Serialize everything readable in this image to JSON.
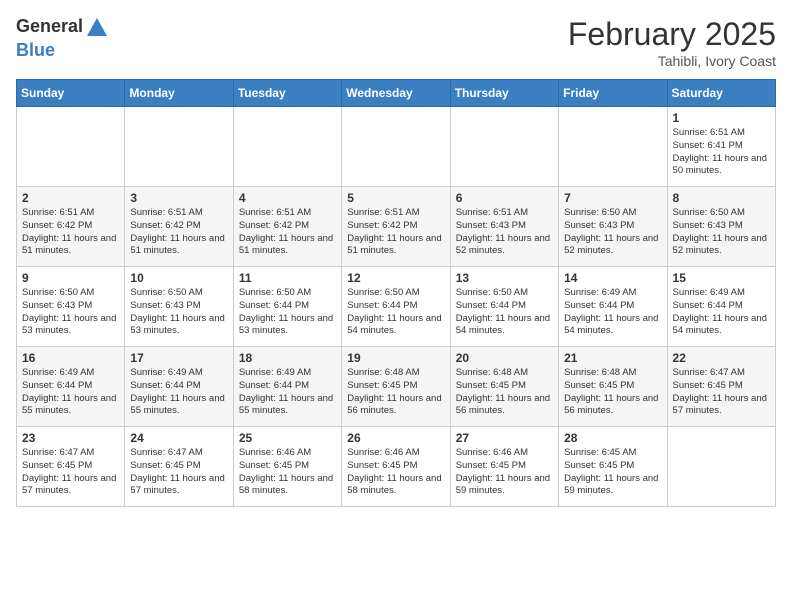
{
  "header": {
    "logo_general": "General",
    "logo_blue": "Blue",
    "month_title": "February 2025",
    "subtitle": "Tahibli, Ivory Coast"
  },
  "days_of_week": [
    "Sunday",
    "Monday",
    "Tuesday",
    "Wednesday",
    "Thursday",
    "Friday",
    "Saturday"
  ],
  "weeks": [
    [
      {
        "day": "",
        "sunrise": "",
        "sunset": "",
        "daylight": ""
      },
      {
        "day": "",
        "sunrise": "",
        "sunset": "",
        "daylight": ""
      },
      {
        "day": "",
        "sunrise": "",
        "sunset": "",
        "daylight": ""
      },
      {
        "day": "",
        "sunrise": "",
        "sunset": "",
        "daylight": ""
      },
      {
        "day": "",
        "sunrise": "",
        "sunset": "",
        "daylight": ""
      },
      {
        "day": "",
        "sunrise": "",
        "sunset": "",
        "daylight": ""
      },
      {
        "day": "1",
        "sunrise": "Sunrise: 6:51 AM",
        "sunset": "Sunset: 6:41 PM",
        "daylight": "Daylight: 11 hours and 50 minutes."
      }
    ],
    [
      {
        "day": "2",
        "sunrise": "Sunrise: 6:51 AM",
        "sunset": "Sunset: 6:42 PM",
        "daylight": "Daylight: 11 hours and 51 minutes."
      },
      {
        "day": "3",
        "sunrise": "Sunrise: 6:51 AM",
        "sunset": "Sunset: 6:42 PM",
        "daylight": "Daylight: 11 hours and 51 minutes."
      },
      {
        "day": "4",
        "sunrise": "Sunrise: 6:51 AM",
        "sunset": "Sunset: 6:42 PM",
        "daylight": "Daylight: 11 hours and 51 minutes."
      },
      {
        "day": "5",
        "sunrise": "Sunrise: 6:51 AM",
        "sunset": "Sunset: 6:42 PM",
        "daylight": "Daylight: 11 hours and 51 minutes."
      },
      {
        "day": "6",
        "sunrise": "Sunrise: 6:51 AM",
        "sunset": "Sunset: 6:43 PM",
        "daylight": "Daylight: 11 hours and 52 minutes."
      },
      {
        "day": "7",
        "sunrise": "Sunrise: 6:50 AM",
        "sunset": "Sunset: 6:43 PM",
        "daylight": "Daylight: 11 hours and 52 minutes."
      },
      {
        "day": "8",
        "sunrise": "Sunrise: 6:50 AM",
        "sunset": "Sunset: 6:43 PM",
        "daylight": "Daylight: 11 hours and 52 minutes."
      }
    ],
    [
      {
        "day": "9",
        "sunrise": "Sunrise: 6:50 AM",
        "sunset": "Sunset: 6:43 PM",
        "daylight": "Daylight: 11 hours and 53 minutes."
      },
      {
        "day": "10",
        "sunrise": "Sunrise: 6:50 AM",
        "sunset": "Sunset: 6:43 PM",
        "daylight": "Daylight: 11 hours and 53 minutes."
      },
      {
        "day": "11",
        "sunrise": "Sunrise: 6:50 AM",
        "sunset": "Sunset: 6:44 PM",
        "daylight": "Daylight: 11 hours and 53 minutes."
      },
      {
        "day": "12",
        "sunrise": "Sunrise: 6:50 AM",
        "sunset": "Sunset: 6:44 PM",
        "daylight": "Daylight: 11 hours and 54 minutes."
      },
      {
        "day": "13",
        "sunrise": "Sunrise: 6:50 AM",
        "sunset": "Sunset: 6:44 PM",
        "daylight": "Daylight: 11 hours and 54 minutes."
      },
      {
        "day": "14",
        "sunrise": "Sunrise: 6:49 AM",
        "sunset": "Sunset: 6:44 PM",
        "daylight": "Daylight: 11 hours and 54 minutes."
      },
      {
        "day": "15",
        "sunrise": "Sunrise: 6:49 AM",
        "sunset": "Sunset: 6:44 PM",
        "daylight": "Daylight: 11 hours and 54 minutes."
      }
    ],
    [
      {
        "day": "16",
        "sunrise": "Sunrise: 6:49 AM",
        "sunset": "Sunset: 6:44 PM",
        "daylight": "Daylight: 11 hours and 55 minutes."
      },
      {
        "day": "17",
        "sunrise": "Sunrise: 6:49 AM",
        "sunset": "Sunset: 6:44 PM",
        "daylight": "Daylight: 11 hours and 55 minutes."
      },
      {
        "day": "18",
        "sunrise": "Sunrise: 6:49 AM",
        "sunset": "Sunset: 6:44 PM",
        "daylight": "Daylight: 11 hours and 55 minutes."
      },
      {
        "day": "19",
        "sunrise": "Sunrise: 6:48 AM",
        "sunset": "Sunset: 6:45 PM",
        "daylight": "Daylight: 11 hours and 56 minutes."
      },
      {
        "day": "20",
        "sunrise": "Sunrise: 6:48 AM",
        "sunset": "Sunset: 6:45 PM",
        "daylight": "Daylight: 11 hours and 56 minutes."
      },
      {
        "day": "21",
        "sunrise": "Sunrise: 6:48 AM",
        "sunset": "Sunset: 6:45 PM",
        "daylight": "Daylight: 11 hours and 56 minutes."
      },
      {
        "day": "22",
        "sunrise": "Sunrise: 6:47 AM",
        "sunset": "Sunset: 6:45 PM",
        "daylight": "Daylight: 11 hours and 57 minutes."
      }
    ],
    [
      {
        "day": "23",
        "sunrise": "Sunrise: 6:47 AM",
        "sunset": "Sunset: 6:45 PM",
        "daylight": "Daylight: 11 hours and 57 minutes."
      },
      {
        "day": "24",
        "sunrise": "Sunrise: 6:47 AM",
        "sunset": "Sunset: 6:45 PM",
        "daylight": "Daylight: 11 hours and 57 minutes."
      },
      {
        "day": "25",
        "sunrise": "Sunrise: 6:46 AM",
        "sunset": "Sunset: 6:45 PM",
        "daylight": "Daylight: 11 hours and 58 minutes."
      },
      {
        "day": "26",
        "sunrise": "Sunrise: 6:46 AM",
        "sunset": "Sunset: 6:45 PM",
        "daylight": "Daylight: 11 hours and 58 minutes."
      },
      {
        "day": "27",
        "sunrise": "Sunrise: 6:46 AM",
        "sunset": "Sunset: 6:45 PM",
        "daylight": "Daylight: 11 hours and 59 minutes."
      },
      {
        "day": "28",
        "sunrise": "Sunrise: 6:45 AM",
        "sunset": "Sunset: 6:45 PM",
        "daylight": "Daylight: 11 hours and 59 minutes."
      },
      {
        "day": "",
        "sunrise": "",
        "sunset": "",
        "daylight": ""
      }
    ]
  ]
}
